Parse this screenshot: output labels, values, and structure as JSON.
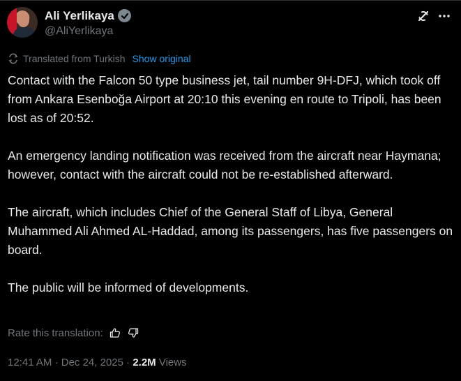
{
  "author": {
    "name": "Ali Yerlikaya",
    "handle": "@AliYerlikaya"
  },
  "header_icons": [
    "grok-icon",
    "more-icon"
  ],
  "translation": {
    "label": "Translated from Turkish",
    "show_original": "Show original"
  },
  "tweet": {
    "paragraphs": [
      "Contact with the Falcon 50 type business jet, tail number 9H-DFJ, which took off from Ankara Esenboğa Airport at 20:10 this evening en route to Tripoli, has been lost as of 20:52.",
      "An emergency landing notification was received from the aircraft near Haymana; however, contact with the aircraft could not be re-established afterward.",
      "The aircraft, which includes Chief of the General Staff of Libya, General Muhammed Ali Ahmed AL-Haddad, among its passengers, has five passengers on board.",
      "The public will be informed of developments."
    ]
  },
  "rating": {
    "label": "Rate this translation:"
  },
  "meta": {
    "time": "12:41 AM",
    "date": "Dec 24, 2025",
    "views_count": "2.2M",
    "views_label": "Views"
  },
  "colors": {
    "background": "#000000",
    "text": "#e7e9ea",
    "secondary": "#71767b",
    "link": "#1d9bf0",
    "badge": "#7d8790"
  }
}
